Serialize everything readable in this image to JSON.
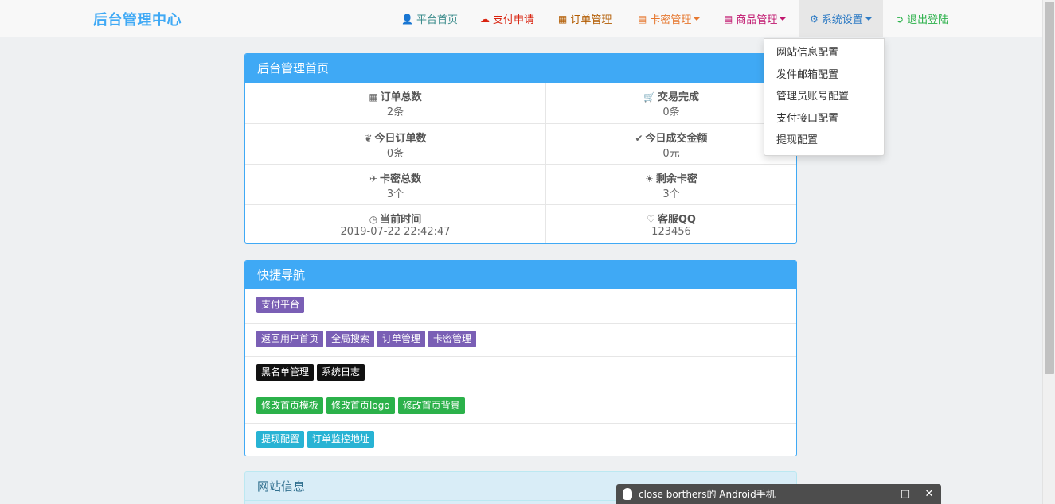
{
  "navbar": {
    "brand": "后台管理中心",
    "items": [
      {
        "label": "平台首页",
        "icon": "user-icon",
        "color": "#3a8b8b"
      },
      {
        "label": "支付申请",
        "icon": "cloud-icon",
        "color": "#d9230f"
      },
      {
        "label": "订单管理",
        "icon": "calendar-icon",
        "color": "#b25b00"
      },
      {
        "label": "卡密管理",
        "icon": "list-icon",
        "color": "#e6772e"
      },
      {
        "label": "商品管理",
        "icon": "book-icon",
        "color": "#c0166e"
      },
      {
        "label": "系统设置",
        "icon": "gear-icon",
        "color": "#2e7bc4"
      },
      {
        "label": "退出登陆",
        "icon": "logout-icon",
        "color": "#2bb14a"
      }
    ]
  },
  "dropdown": {
    "items": [
      "网站信息配置",
      "发件邮箱配置",
      "管理员账号配置",
      "支付接口配置",
      "提现配置"
    ]
  },
  "dashboard": {
    "title": "后台管理首页",
    "stats": [
      {
        "label": "订单总数",
        "value": "2条",
        "icon": "grid-icon"
      },
      {
        "label": "交易完成",
        "value": "0条",
        "icon": "cart-icon"
      },
      {
        "label": "今日订单数",
        "value": "0条",
        "icon": "leaf-icon"
      },
      {
        "label": "今日成交金额",
        "value": "0元",
        "icon": "check-icon"
      },
      {
        "label": "卡密总数",
        "value": "3个",
        "icon": "plane-icon"
      },
      {
        "label": "剩余卡密",
        "value": "3个",
        "icon": "sun-icon"
      },
      {
        "label": "当前时间",
        "value": "2019-07-22 22:42:47",
        "icon": "clock-icon"
      },
      {
        "label": "客服QQ",
        "value": "123456",
        "icon": "heart-icon"
      }
    ]
  },
  "quicknav": {
    "title": "快捷导航",
    "rows": [
      [
        "支付平台"
      ],
      [
        "返回用户首页",
        "全局搜索",
        "订单管理",
        "卡密管理"
      ],
      [
        "黑名单管理",
        "系统日志"
      ],
      [
        "修改首页模板",
        "修改首页logo",
        "修改首页背景"
      ],
      [
        "提现配置",
        "订单监控地址"
      ]
    ]
  },
  "siteinfo": {
    "title": "网站信息"
  },
  "qq_popup": {
    "title": "close borthers的 Android手机"
  },
  "colors": {
    "primary": "#3fa9f5",
    "label_purple": "#7a5fb5",
    "label_black": "#111111",
    "label_green": "#2bb14a",
    "label_cyan": "#28b3d4"
  }
}
